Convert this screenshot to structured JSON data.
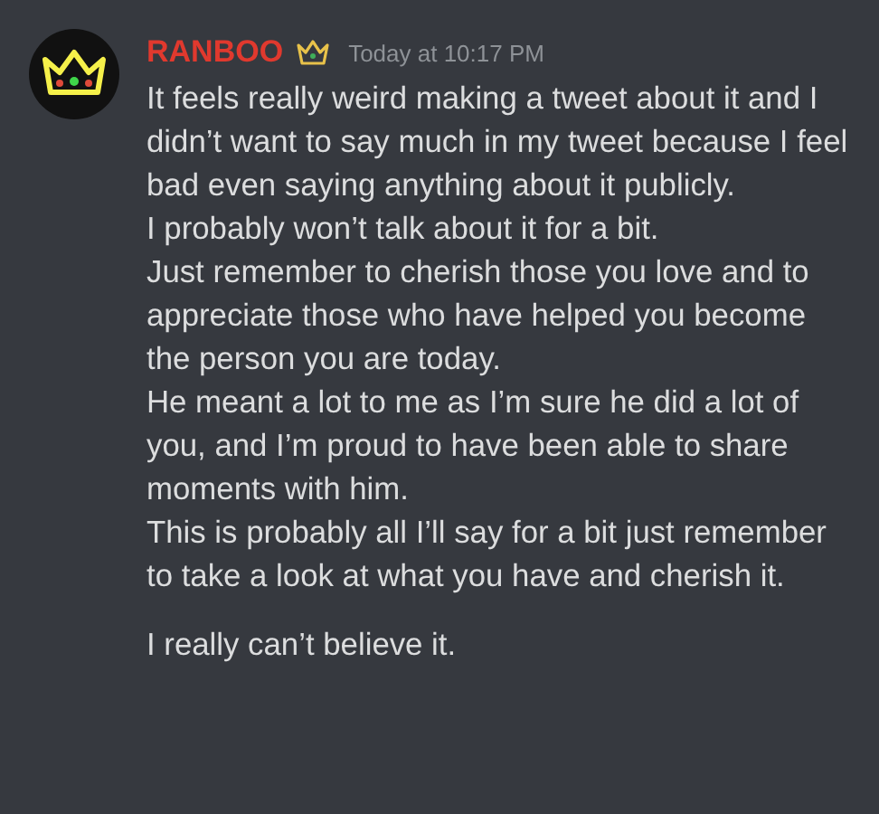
{
  "message": {
    "author": "RANBOO",
    "timestamp": "Today at 10:17 PM",
    "lines": [
      "It feels really weird making a tweet about it and I didn’t want to say much in my tweet because I feel bad even saying anything about it publicly.",
      "I probably won’t talk about it for a bit.",
      "Just remember to cherish those you love and to appreciate those who have helped you become the person you are today.",
      "He meant a lot to me as I’m sure he did a lot of you, and I’m proud to have been able to share moments with him.",
      "This is probably all I’ll say for a bit just remember to take a look at what you have and cherish it."
    ]
  },
  "followup": {
    "text": "I really can’t believe it."
  }
}
